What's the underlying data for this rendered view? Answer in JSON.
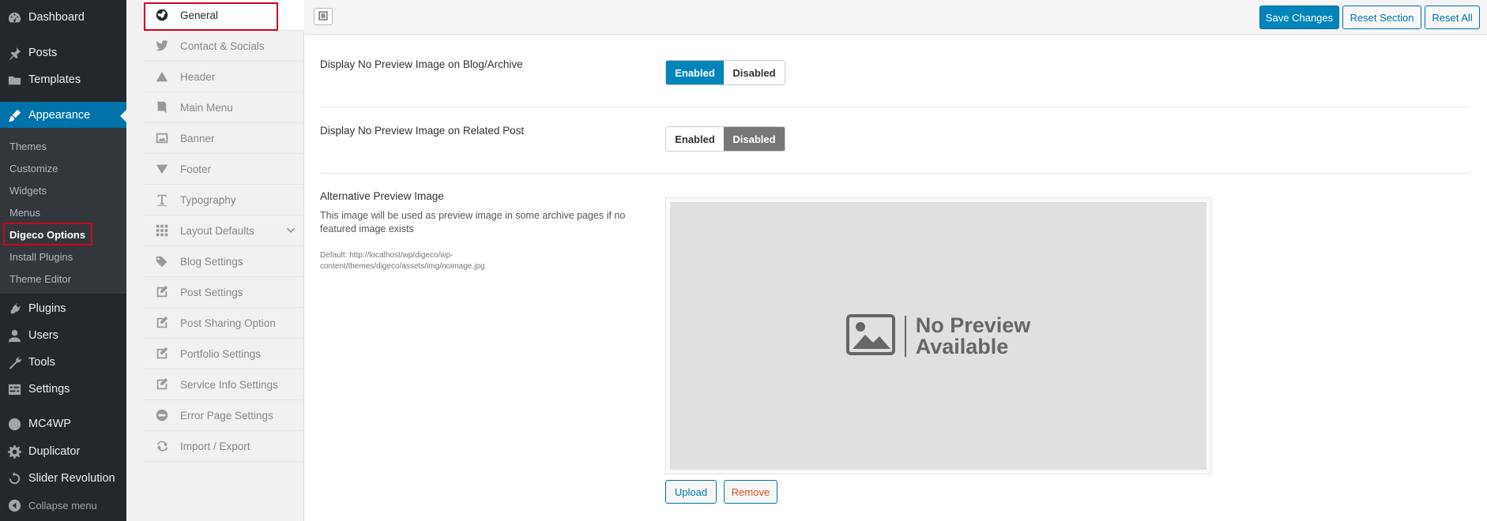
{
  "wp_menu": {
    "dashboard": "Dashboard",
    "posts": "Posts",
    "templates": "Templates",
    "appearance": "Appearance",
    "submenu": [
      "Themes",
      "Customize",
      "Widgets",
      "Menus",
      "Digeco Options",
      "Install Plugins",
      "Theme Editor"
    ],
    "plugins": "Plugins",
    "users": "Users",
    "tools": "Tools",
    "settings": "Settings",
    "mc4wp": "MC4WP",
    "duplicator": "Duplicator",
    "slider_revolution": "Slider Revolution",
    "collapse": "Collapse menu"
  },
  "options_nav": [
    {
      "label": "General",
      "icon": "globe-icon"
    },
    {
      "label": "Contact & Socials",
      "icon": "twitter-icon"
    },
    {
      "label": "Header",
      "icon": "triangle-up-icon"
    },
    {
      "label": "Main Menu",
      "icon": "book-icon"
    },
    {
      "label": "Banner",
      "icon": "image-icon"
    },
    {
      "label": "Footer",
      "icon": "triangle-down-icon"
    },
    {
      "label": "Typography",
      "icon": "text-icon"
    },
    {
      "label": "Layout Defaults",
      "icon": "grid-icon"
    },
    {
      "label": "Blog Settings",
      "icon": "tags-icon"
    },
    {
      "label": "Post Settings",
      "icon": "edit-icon"
    },
    {
      "label": "Post Sharing Option",
      "icon": "edit-icon"
    },
    {
      "label": "Portfolio Settings",
      "icon": "edit-icon"
    },
    {
      "label": "Service Info Settings",
      "icon": "edit-icon"
    },
    {
      "label": "Error Page Settings",
      "icon": "minus-circle-icon"
    },
    {
      "label": "Import / Export",
      "icon": "refresh-icon"
    }
  ],
  "header": {
    "save": "Save Changes",
    "reset_section": "Reset Section",
    "reset_all": "Reset All"
  },
  "fields": {
    "blog_archive": {
      "label": "Display No Preview Image on Blog/Archive",
      "enabled": "Enabled",
      "disabled": "Disabled",
      "value": "Enabled"
    },
    "related_post": {
      "label": "Display No Preview Image on Related Post",
      "enabled": "Enabled",
      "disabled": "Disabled",
      "value": "Disabled"
    },
    "alt_image": {
      "label": "Alternative Preview Image",
      "description": "This image will be used as preview image in some archive pages if no featured image exists",
      "default": "Default: http://localhost/wp/digeco/wp-content/themes/digeco/assets/img/noimage.jpg",
      "preview_line1": "No Preview",
      "preview_line2": "Available",
      "upload": "Upload",
      "remove": "Remove"
    }
  },
  "colors": {
    "wp_sidebar": "#23282d",
    "wp_active": "#0073aa",
    "primary": "#0085ba",
    "highlight": "#d0021b"
  }
}
